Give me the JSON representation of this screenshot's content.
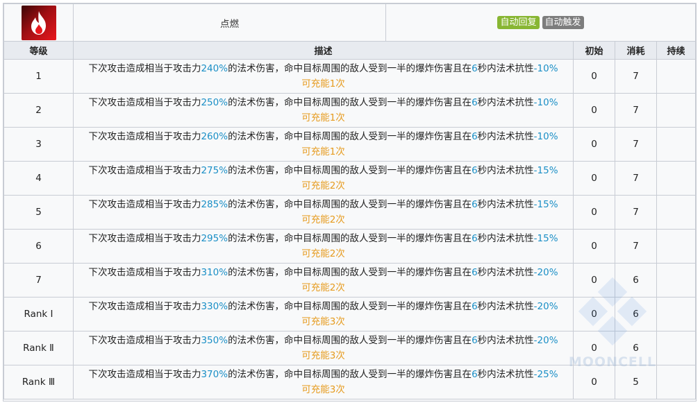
{
  "skill": {
    "name": "点燃",
    "icon": "fire-icon",
    "tags": [
      {
        "label": "自动回复",
        "color": "#88b633"
      },
      {
        "label": "自动触发",
        "color": "#7d7d7d"
      }
    ]
  },
  "columns": {
    "level": "等级",
    "desc": "描述",
    "initial": "初始",
    "cost": "消耗",
    "duration": "持续"
  },
  "desc_parts": {
    "p1": "下次攻击造成相当于攻击力",
    "p2": "的法术伤害，命中目标周围的敌人受到一半的爆炸伤害且在",
    "p3": "6",
    "p4": "秒内法术抗性",
    "charge_prefix": "可充能",
    "charge_suffix": "次"
  },
  "rows": [
    {
      "level": "1",
      "atk": "240%",
      "res": "-10%",
      "charges": "1",
      "initial": "0",
      "cost": "7",
      "duration": ""
    },
    {
      "level": "2",
      "atk": "250%",
      "res": "-10%",
      "charges": "1",
      "initial": "0",
      "cost": "7",
      "duration": ""
    },
    {
      "level": "3",
      "atk": "260%",
      "res": "-10%",
      "charges": "1",
      "initial": "0",
      "cost": "7",
      "duration": ""
    },
    {
      "level": "4",
      "atk": "275%",
      "res": "-15%",
      "charges": "2",
      "initial": "0",
      "cost": "7",
      "duration": ""
    },
    {
      "level": "5",
      "atk": "285%",
      "res": "-15%",
      "charges": "2",
      "initial": "0",
      "cost": "7",
      "duration": ""
    },
    {
      "level": "6",
      "atk": "295%",
      "res": "-15%",
      "charges": "2",
      "initial": "0",
      "cost": "7",
      "duration": ""
    },
    {
      "level": "7",
      "atk": "310%",
      "res": "-20%",
      "charges": "2",
      "initial": "0",
      "cost": "6",
      "duration": ""
    },
    {
      "level": "Rank Ⅰ",
      "atk": "330%",
      "res": "-20%",
      "charges": "3",
      "initial": "0",
      "cost": "6",
      "duration": ""
    },
    {
      "level": "Rank Ⅱ",
      "atk": "350%",
      "res": "-20%",
      "charges": "3",
      "initial": "0",
      "cost": "6",
      "duration": ""
    },
    {
      "level": "Rank Ⅲ",
      "atk": "370%",
      "res": "-25%",
      "charges": "3",
      "initial": "0",
      "cost": "5",
      "duration": ""
    }
  ],
  "watermark": {
    "text": "MOONCELL",
    "icon": "mooncell-logo-icon"
  },
  "colors": {
    "highlight": "#1b8fc6",
    "charge": "#e69b1e",
    "header_bg": "#e8ebf0"
  }
}
